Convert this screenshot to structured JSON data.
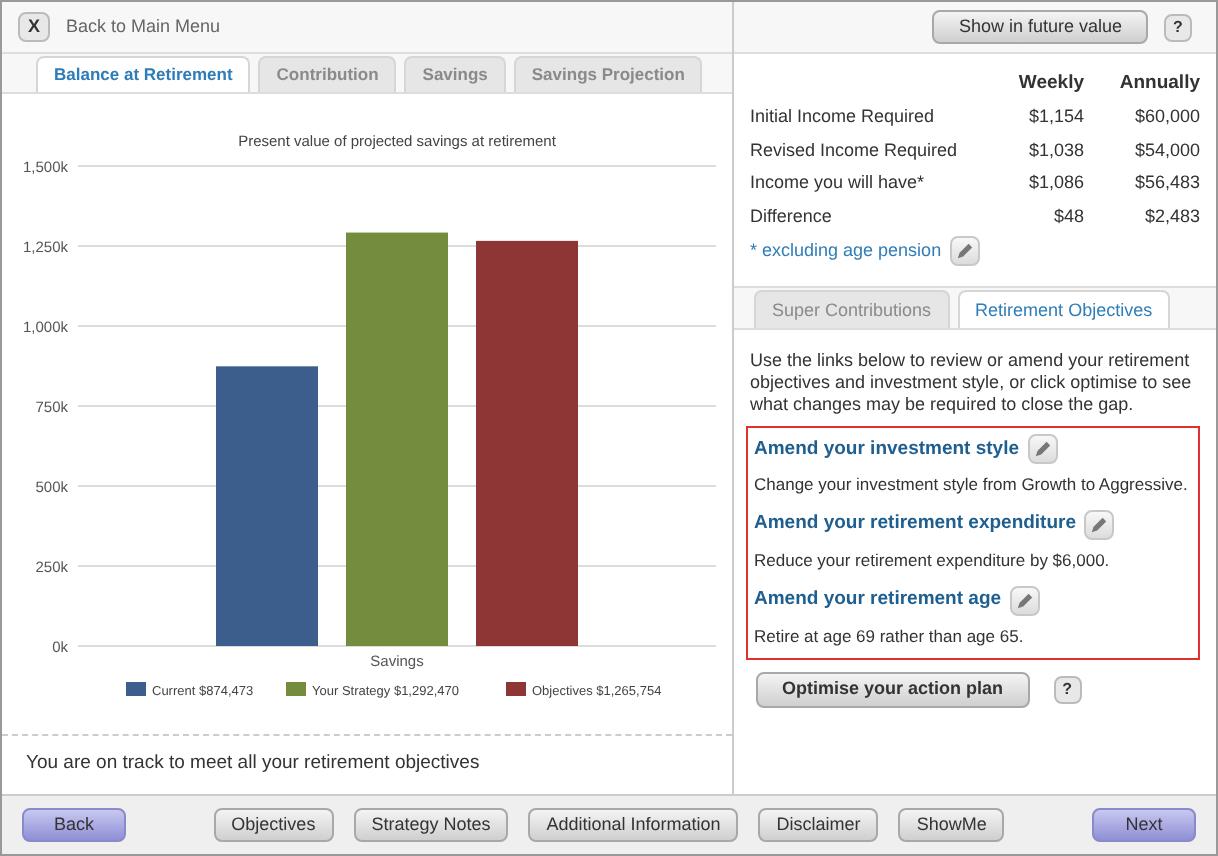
{
  "top_bar": {
    "close_label": "X",
    "back_link": "Back to Main Menu",
    "future_button": "Show in future value",
    "help": "?"
  },
  "left_tabs": [
    {
      "label": "Balance at Retirement",
      "selected": true
    },
    {
      "label": "Contribution",
      "selected": false
    },
    {
      "label": "Savings",
      "selected": false
    },
    {
      "label": "Savings Projection",
      "selected": false
    }
  ],
  "chart": {
    "chart_data": {
      "type": "bar",
      "grid": true,
      "legend": true,
      "title": "Present value of projected savings at retirement",
      "categories": [
        "Savings"
      ],
      "series": [
        {
          "name": "Current $874,473",
          "color": "#3b5e8c",
          "values": [
            874000
          ]
        },
        {
          "name": "Your Strategy $1,292,470",
          "color": "#748c3e",
          "values": [
            1292000
          ]
        },
        {
          "name": "Objectives $1,265,754",
          "color": "#8e3636",
          "values": [
            1266000
          ]
        }
      ],
      "ylim": [
        0,
        1500000
      ],
      "yticks": [
        {
          "value": 0,
          "label": "0k"
        },
        {
          "value": 250000,
          "label": "250k"
        },
        {
          "value": 500000,
          "label": "500k"
        },
        {
          "value": 750000,
          "label": "750k"
        },
        {
          "value": 1000000,
          "label": "1,000k"
        },
        {
          "value": 1250000,
          "label": "1,250k"
        },
        {
          "value": 1500000,
          "label": "1,500k"
        }
      ]
    }
  },
  "status_message": "You are on track to meet all your retirement objectives",
  "income_table": {
    "columns": [
      "Weekly",
      "Annually"
    ],
    "rows": [
      {
        "label": "Initial Income Required",
        "weekly": "$1,154",
        "annually": "$60,000"
      },
      {
        "label": "Revised Income Required",
        "weekly": "$1,038",
        "annually": "$54,000"
      },
      {
        "label": "Income you will have*",
        "weekly": "$1,086",
        "annually": "$56,483"
      },
      {
        "label": "Difference",
        "weekly": "$48",
        "annually": "$2,483"
      }
    ],
    "footnote_link": "* excluding age pension"
  },
  "right_tabs": [
    {
      "label": "Super Contributions",
      "selected": false
    },
    {
      "label": "Retirement Objectives",
      "selected": true
    }
  ],
  "objectives": {
    "intro": "Use the links below to review or amend your retirement objectives and investment style, or click optimise to see what changes may be required to close the gap.",
    "amendments": [
      {
        "link": "Amend your investment style",
        "description": "Change your investment style from Growth to Aggressive."
      },
      {
        "link": "Amend your retirement expenditure",
        "description": "Reduce your retirement expenditure by $6,000."
      },
      {
        "link": "Amend your retirement age",
        "description": "Retire at age 69 rather than age 65."
      }
    ],
    "optimise_button": "Optimise your action plan",
    "help": "?"
  },
  "footer": {
    "back": "Back",
    "buttons": [
      "Objectives",
      "Strategy Notes",
      "Additional Information",
      "Disclaimer",
      "ShowMe"
    ],
    "next": "Next"
  }
}
